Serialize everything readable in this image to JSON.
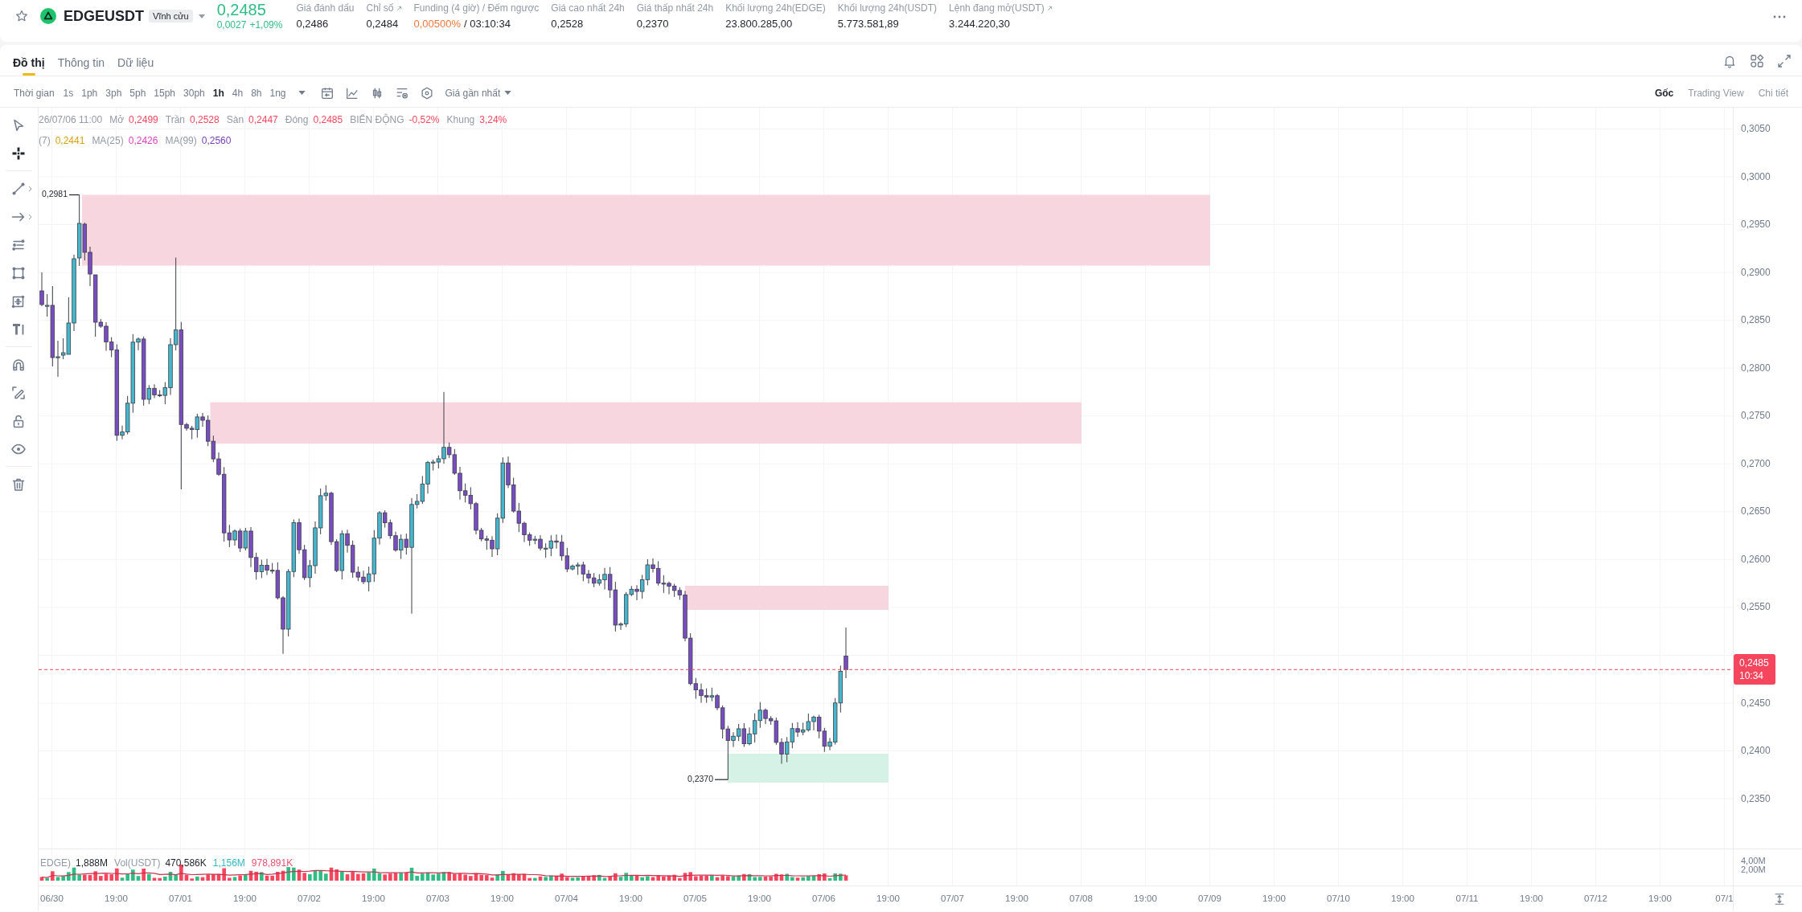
{
  "header": {
    "symbol": "EDGEUSDT",
    "contract_type": "Vĩnh cửu",
    "last_price": "0,2485",
    "change": "0,0027",
    "change_percent": "+1,09%",
    "stats": [
      {
        "kind": "plain",
        "label": "Giá đánh dấu",
        "value": "0,2486",
        "link": false
      },
      {
        "kind": "plain",
        "label": "Chỉ số",
        "value": "0,2484",
        "link": true
      },
      {
        "kind": "funding",
        "label": "Funding (4 giờ) / Đếm ngược",
        "rate": "0,00500%",
        "value": "/ 03:10:34",
        "link": false
      },
      {
        "kind": "plain",
        "label": "Giá cao nhất 24h",
        "value": "0,2528",
        "link": false
      },
      {
        "kind": "plain",
        "label": "Giá thấp nhất 24h",
        "value": "0,2370",
        "link": false
      },
      {
        "kind": "plain",
        "label": "Khối lượng 24h(EDGE)",
        "value": "23.800.285,00",
        "link": false
      },
      {
        "kind": "plain",
        "label": "Khối lượng 24h(USDT)",
        "value": "5.773.581,89",
        "link": false
      },
      {
        "kind": "plain",
        "label": "Lệnh đang mở(USDT)",
        "value": "3.244.220,30",
        "link": true
      }
    ]
  },
  "tabs": [
    {
      "label": "Đồ thị",
      "selected": true
    },
    {
      "label": "Thông tin",
      "selected": false
    },
    {
      "label": "Dữ liệu",
      "selected": false
    }
  ],
  "toolbar": {
    "label": "Thời gian",
    "intervals": [
      {
        "label": "1s",
        "selected": false
      },
      {
        "label": "1ph",
        "selected": false
      },
      {
        "label": "3ph",
        "selected": false
      },
      {
        "label": "5ph",
        "selected": false
      },
      {
        "label": "15ph",
        "selected": false
      },
      {
        "label": "30ph",
        "selected": false
      },
      {
        "label": "1h",
        "selected": true
      },
      {
        "label": "4h",
        "selected": false
      },
      {
        "label": "8h",
        "selected": false
      },
      {
        "label": "1ng",
        "selected": false
      }
    ],
    "price_source": "Giá gần nhất",
    "views": [
      {
        "label": "Gốc",
        "selected": true
      },
      {
        "label": "Trading View",
        "selected": false
      },
      {
        "label": "Chi tiết",
        "selected": false
      }
    ]
  },
  "tools": [
    {
      "kind": "cursor",
      "selected": false,
      "submenu": false
    },
    {
      "kind": "crosshair",
      "selected": true,
      "submenu": false
    },
    {
      "kind": "trend-line",
      "selected": false,
      "submenu": true
    },
    {
      "kind": "arrow",
      "selected": false,
      "submenu": true
    },
    {
      "kind": "fib",
      "selected": false,
      "submenu": false
    },
    {
      "kind": "shape",
      "selected": false,
      "submenu": false
    },
    {
      "kind": "measure",
      "selected": false,
      "submenu": false
    },
    {
      "kind": "text",
      "selected": false,
      "submenu": false
    },
    {
      "kind": "magnet",
      "selected": false,
      "submenu": false
    },
    {
      "kind": "edit",
      "selected": false,
      "submenu": false
    },
    {
      "kind": "lock",
      "selected": false,
      "submenu": false
    },
    {
      "kind": "eye",
      "selected": false,
      "submenu": false
    },
    {
      "kind": "trash",
      "selected": false,
      "submenu": false
    }
  ],
  "legend": {
    "time": "26/07/06 11:00",
    "fields": [
      {
        "label": "Mở",
        "value": "0,2499"
      },
      {
        "label": "Trần",
        "value": "0,2528"
      },
      {
        "label": "Sàn",
        "value": "0,2447"
      },
      {
        "label": "Đóng",
        "value": "0,2485"
      },
      {
        "label": "BIẾN ĐỘNG",
        "value": "-0,52%"
      },
      {
        "label": "Khung",
        "value": "3,24%"
      }
    ],
    "averages": [
      {
        "label": "(7)",
        "value": "0,2441",
        "color": "#d9a20e"
      },
      {
        "label": "MA(25)",
        "value": "0,2426",
        "color": "#e040bf"
      },
      {
        "label": "MA(99)",
        "value": "0,2560",
        "color": "#7a3db8"
      }
    ]
  },
  "chart": {
    "high_label": "0,2981",
    "low_label": "0,2370",
    "last_price": "0,2485",
    "countdown": "10:34"
  },
  "price_axis": {
    "upper_ticks": [
      "0,3050",
      "0,3000",
      "0,2950",
      "0,2900",
      "0,2850",
      "0,2800",
      "0,2750",
      "0,2700",
      "0,2650",
      "0,2600",
      "0,2550"
    ],
    "lower_ticks": [
      "0,2450",
      "0,2400",
      "0,2350"
    ]
  },
  "volume": {
    "legend": [
      {
        "label": "EDGE)",
        "value": "1,888M",
        "color": "#1e2329"
      },
      {
        "label": "Vol(USDT)",
        "value": "470,586K",
        "color": "#1e2329"
      },
      {
        "value": "1,156M",
        "color": "#2fb8c4"
      },
      {
        "value": "978,891K",
        "color": "#f0506e"
      }
    ],
    "axis": [
      "4,00M",
      "2,00M"
    ]
  },
  "time_axis": {
    "labels": [
      "06/30",
      "19:00",
      "07/01",
      "19:00",
      "07/02",
      "19:00",
      "07/03",
      "19:00",
      "07/04",
      "19:00",
      "07/05",
      "19:00",
      "07/06",
      "19:00",
      "07/07",
      "19:00",
      "07/08",
      "19:00",
      "07/09",
      "19:00",
      "07/10",
      "19:00",
      "07/11",
      "19:00",
      "07/12",
      "19:00",
      "07/1"
    ]
  }
}
